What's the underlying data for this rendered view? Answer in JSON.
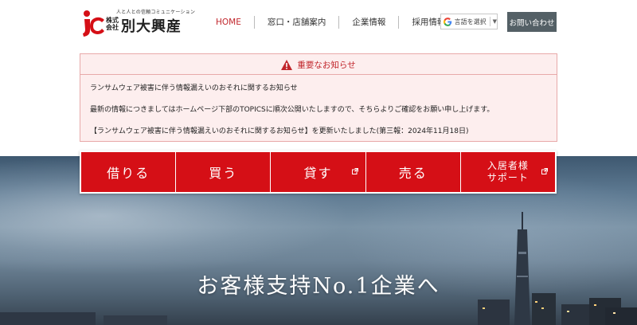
{
  "brand": {
    "tagline": "人と人との信頼コミュニケーション",
    "company_prefix": "株式\n会社",
    "company_name": "別大興産",
    "accent": "#d50f16"
  },
  "nav": {
    "items": [
      {
        "label": "HOME",
        "active": true
      },
      {
        "label": "窓口・店舗案内",
        "active": false
      },
      {
        "label": "企業情報",
        "active": false
      },
      {
        "label": "採用情報",
        "active": false
      }
    ]
  },
  "language": {
    "label": "言語を選択",
    "caret": "▼",
    "icon": "google-g-icon"
  },
  "contact": {
    "label": "お問い合わせ",
    "color": "#546066"
  },
  "notice": {
    "heading": "重要なお知らせ",
    "icon": "warning-icon",
    "lines": [
      "ランサムウェア被害に伴う情報漏えいのおそれに関するお知らせ",
      "最新の情報につきましてはホームページ下部のTOPICSに順次公開いたしますので、そちらよりご確認をお願い申し上げます。",
      "【ランサムウェア被害に伴う情報漏えいのおそれに関するお知らせ】を更新いたしました(第三報：2024年11月18日)"
    ]
  },
  "menu": {
    "items": [
      {
        "label": "借りる",
        "external": false
      },
      {
        "label": "買う",
        "external": false
      },
      {
        "label": "貸す",
        "external": true
      },
      {
        "label": "売る",
        "external": false
      },
      {
        "label": "入居者様\nサポート",
        "external": true
      }
    ]
  },
  "hero": {
    "title": "お客様支持No.1企業へ"
  }
}
